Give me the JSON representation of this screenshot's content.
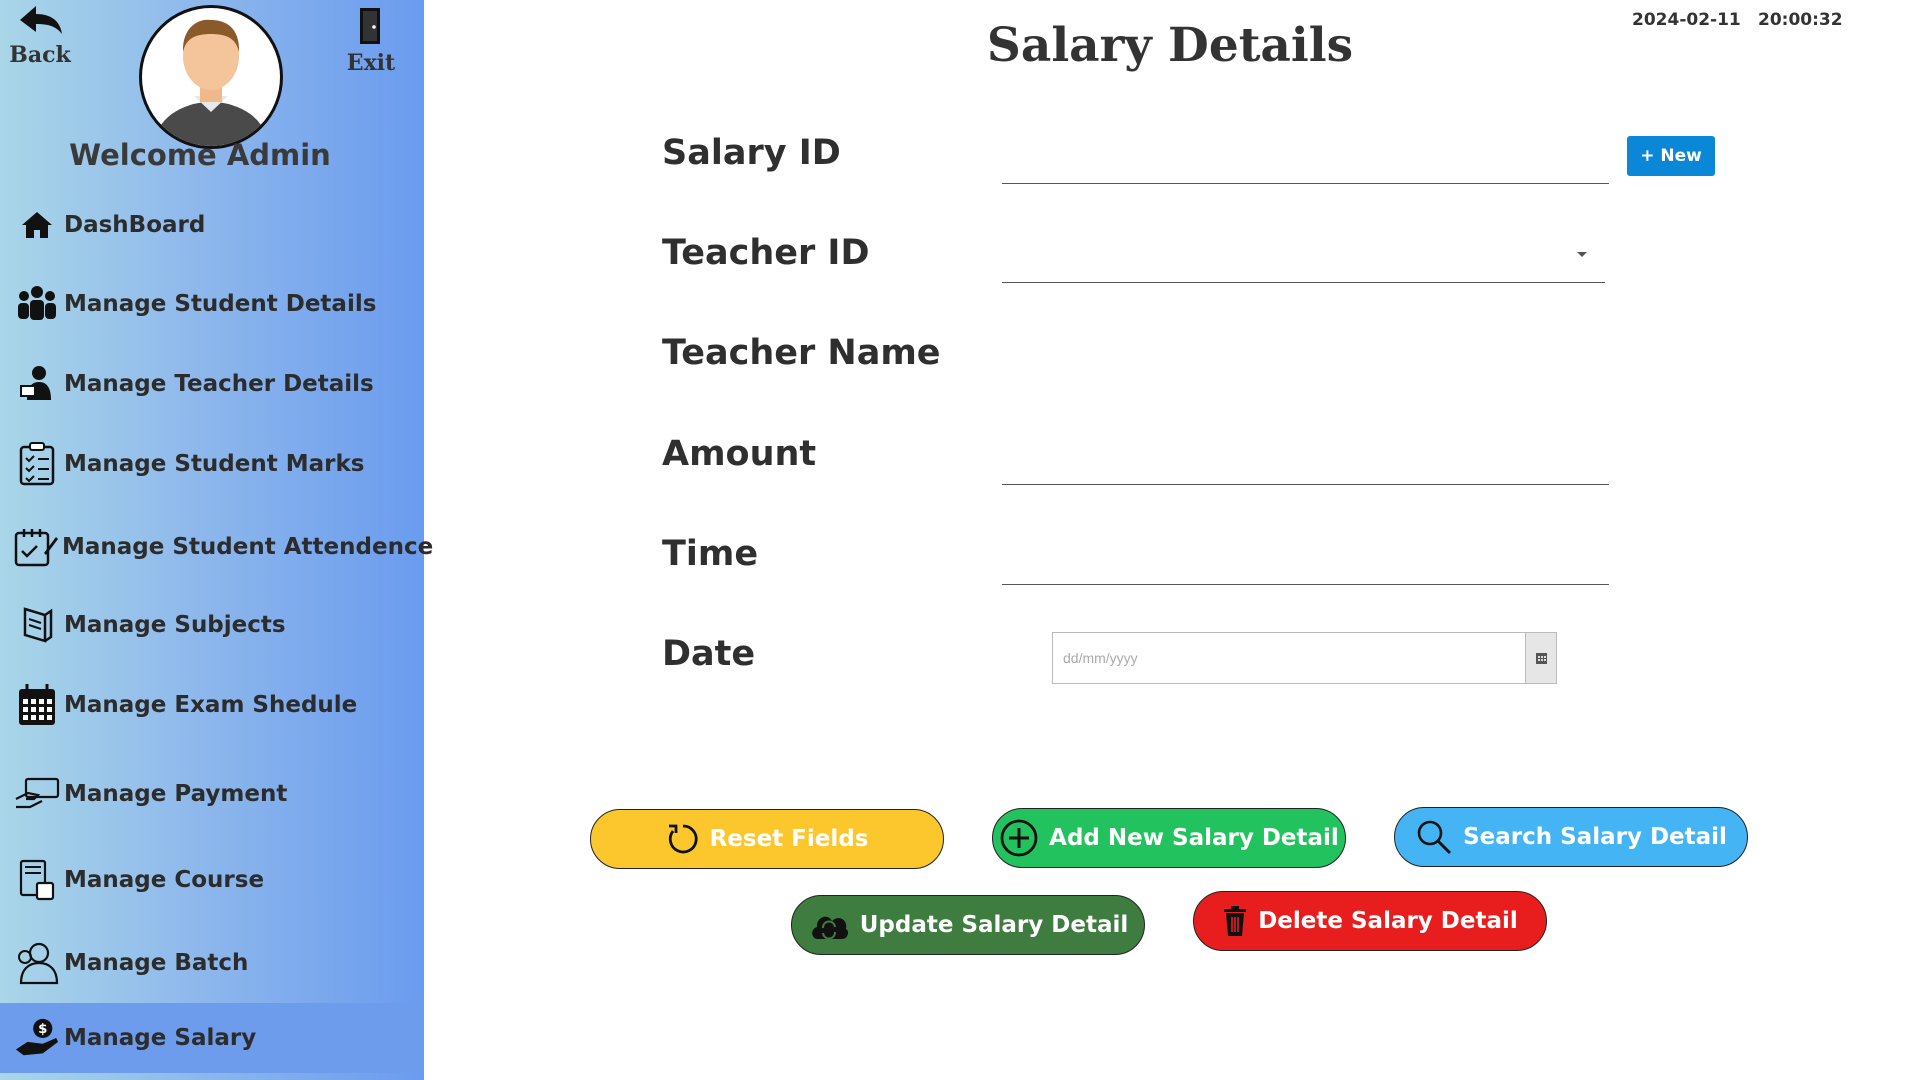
{
  "header": {
    "back_label": "Back",
    "exit_label": "Exit",
    "welcome": "Welcome Admin",
    "date": "2024-02-11",
    "time": "20:00:32"
  },
  "sidebar": {
    "items": [
      {
        "label": "DashBoard",
        "icon": "home-icon"
      },
      {
        "label": "Manage Student Details",
        "icon": "students-group-icon"
      },
      {
        "label": "Manage Teacher Details",
        "icon": "teacher-icon"
      },
      {
        "label": "Manage Student Marks",
        "icon": "checklist-icon"
      },
      {
        "label": "Manage Student Attendence",
        "icon": "attendance-icon"
      },
      {
        "label": "Manage Subjects",
        "icon": "book-icon"
      },
      {
        "label": "Manage Exam Shedule",
        "icon": "calendar-icon"
      },
      {
        "label": "Manage Payment",
        "icon": "payment-hand-icon"
      },
      {
        "label": "Manage Course",
        "icon": "course-icon"
      },
      {
        "label": "Manage Batch",
        "icon": "batch-user-icon"
      },
      {
        "label": "Manage Salary",
        "icon": "salary-hand-icon",
        "active": true
      }
    ]
  },
  "main": {
    "title": "Salary Details",
    "fields": {
      "salary_id": "Salary ID",
      "teacher_id": "Teacher ID",
      "teacher_name": "Teacher Name",
      "amount": "Amount",
      "time": "Time",
      "date": "Date"
    },
    "new_button": "+ New",
    "date_placeholder": "dd/mm/yyyy"
  },
  "buttons": {
    "reset": "Reset Fields",
    "add": "Add New Salary Detail",
    "search": "Search Salary Detail",
    "update": "Update Salary Detail",
    "delete": "Delete Salary Detail"
  },
  "colors": {
    "reset": "#fcc72c",
    "add": "#22c35e",
    "search": "#44b4f4",
    "update": "#3e7c3f",
    "delete": "#e81e1e",
    "new_button": "#0a87d6",
    "sidebar_active": "#6e9cec"
  }
}
